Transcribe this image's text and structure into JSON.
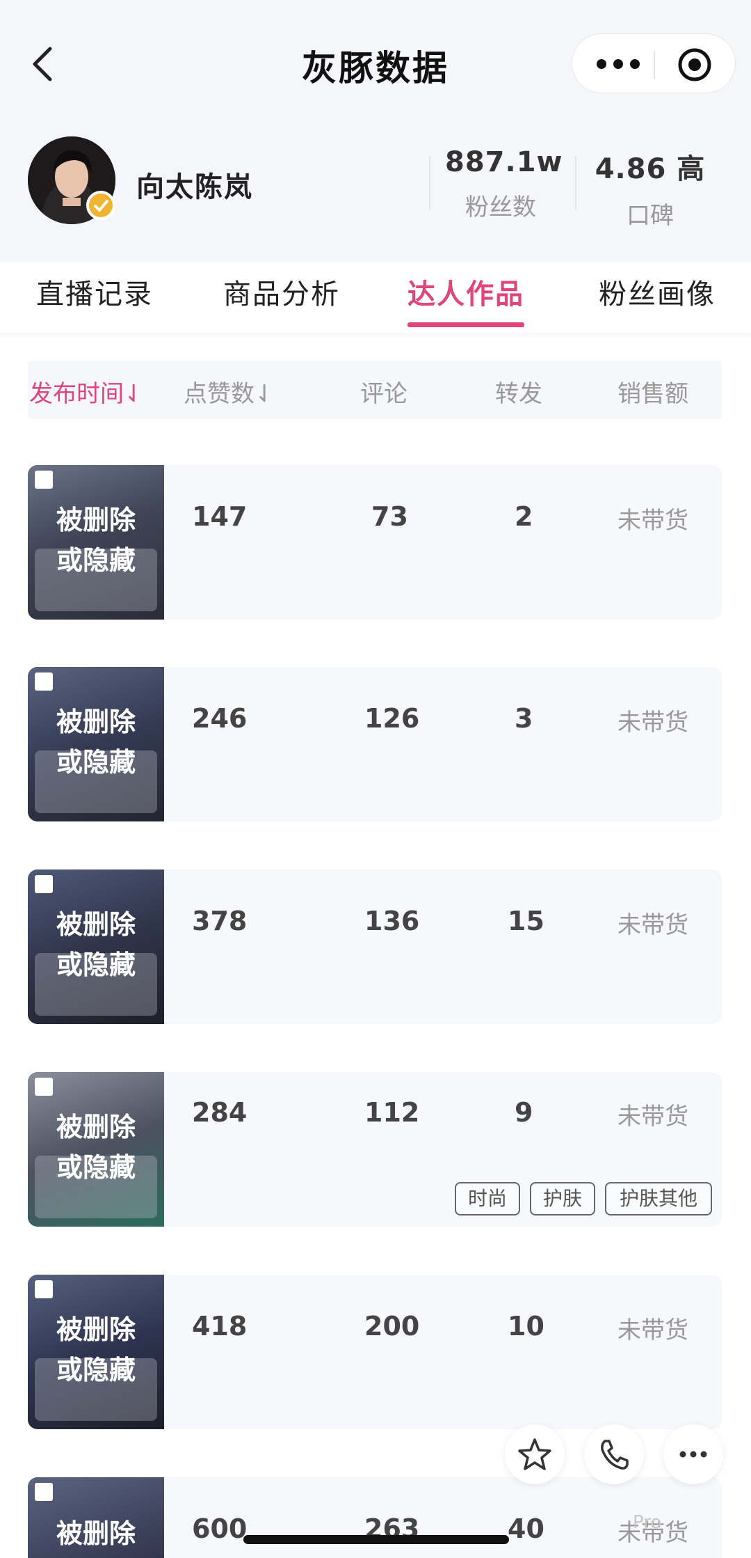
{
  "header": {
    "title": "灰豚数据"
  },
  "account": {
    "name": "向太陈岚",
    "fans_value": "887.1w",
    "fans_label": "粉丝数",
    "reputation_value": "4.86 高",
    "reputation_label": "口碑"
  },
  "tabs": [
    {
      "label": "直播记录",
      "active": false
    },
    {
      "label": "商品分析",
      "active": false
    },
    {
      "label": "达人作品",
      "active": true
    },
    {
      "label": "粉丝画像",
      "active": false
    }
  ],
  "table": {
    "headers": [
      "发布时间⇃",
      "点赞数⇃",
      "评论",
      "转发",
      "销售额"
    ],
    "rows": [
      {
        "overlay": "被删除\n或隐藏",
        "likes": "147",
        "comments": "73",
        "shares": "2",
        "sales": "未带货",
        "tags": []
      },
      {
        "overlay": "被删除\n或隐藏",
        "likes": "246",
        "comments": "126",
        "shares": "3",
        "sales": "未带货",
        "tags": []
      },
      {
        "overlay": "被删除\n或隐藏",
        "likes": "378",
        "comments": "136",
        "shares": "15",
        "sales": "未带货",
        "tags": []
      },
      {
        "overlay": "被删除\n或隐藏",
        "likes": "284",
        "comments": "112",
        "shares": "9",
        "sales": "未带货",
        "tags": [
          "时尚",
          "护肤",
          "护肤其他"
        ]
      },
      {
        "overlay": "被删除\n或隐藏",
        "likes": "418",
        "comments": "200",
        "shares": "10",
        "sales": "未带货",
        "tags": []
      },
      {
        "overlay": "被删除",
        "likes": "600",
        "comments": "263",
        "shares": "40",
        "sales": "未带货",
        "tags": []
      }
    ]
  },
  "floating_actions": [
    {
      "icon": "star-icon"
    },
    {
      "icon": "phone-icon"
    },
    {
      "icon": "more-icon"
    }
  ],
  "watermark": "Pro",
  "colors": {
    "accent": "#e0457b",
    "badge": "#f1b431"
  }
}
